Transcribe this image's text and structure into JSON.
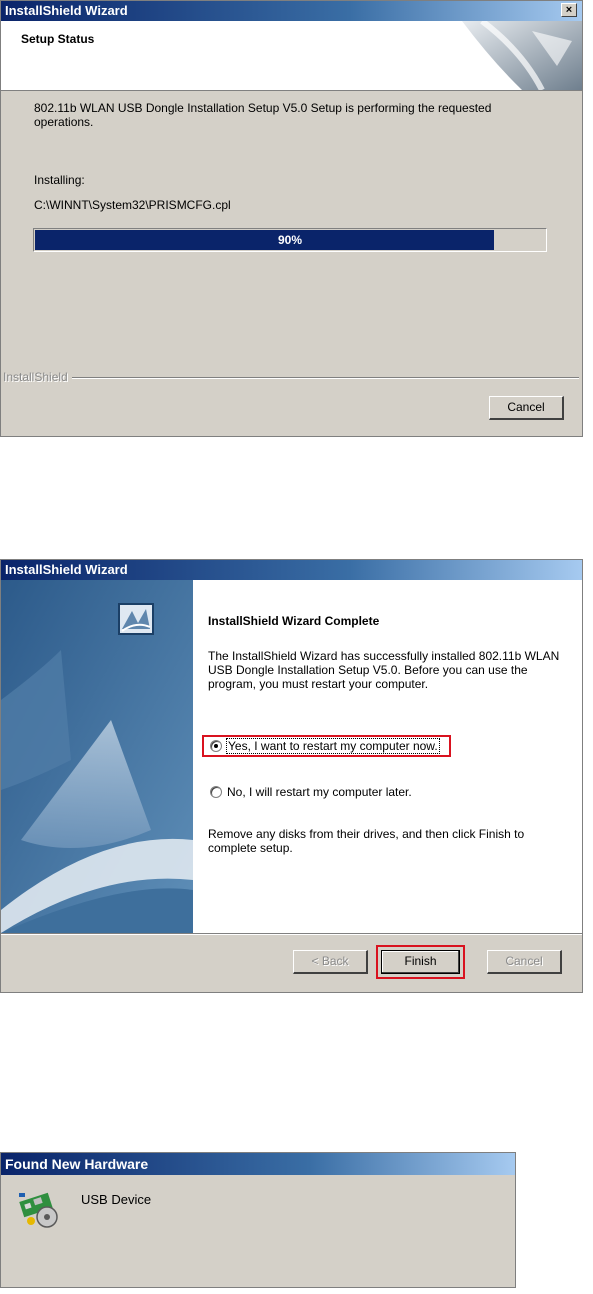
{
  "setup_status": {
    "title": "InstallShield Wizard",
    "close_glyph": "×",
    "header_title": "Setup Status",
    "message": "802.11b WLAN USB Dongle Installation Setup V5.0 Setup is performing the requested operations.",
    "installing_label": "Installing:",
    "file_path": "C:\\WINNT\\System32\\PRISMCFG.cpl",
    "progress_percent": 90,
    "progress_text": "90%",
    "brand_label": "InstallShield",
    "cancel_label": "Cancel"
  },
  "complete": {
    "title": "InstallShield Wizard",
    "heading": "InstallShield Wizard Complete",
    "message": "The InstallShield Wizard has successfully installed 802.11b WLAN USB Dongle Installation Setup V5.0.  Before you can use the program, you must restart your computer.",
    "option_yes": "Yes, I want to restart my computer now.",
    "option_no": "No, I will restart my computer later.",
    "selected_option": "yes",
    "footer_message": "Remove any disks from their drives, and then click Finish to complete setup.",
    "back_label": "< Back",
    "finish_label": "Finish",
    "cancel_label": "Cancel"
  },
  "found_hardware": {
    "title": "Found New Hardware",
    "device_name": "USB Device",
    "icon": "hardware-wizard-icon"
  },
  "colors": {
    "title_start": "#0a246a",
    "title_end": "#a6caf0",
    "progress_fill": "#0a246a",
    "highlight_red": "#d9121f",
    "dialog_face": "#d4d0c8"
  }
}
